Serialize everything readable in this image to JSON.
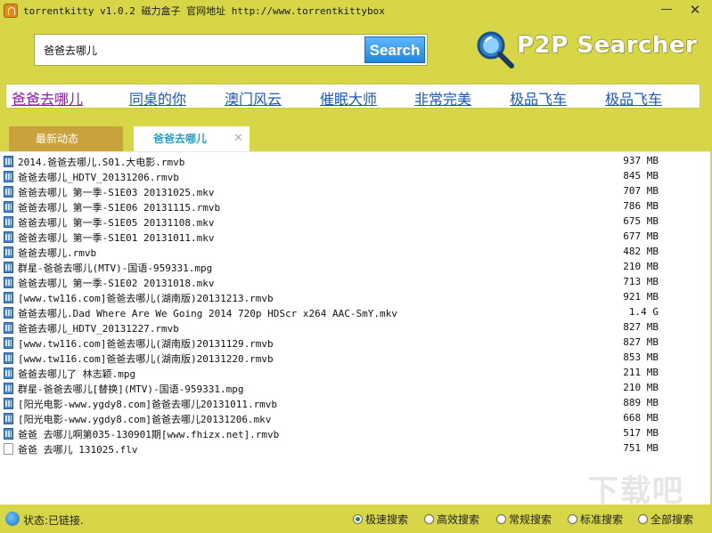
{
  "window": {
    "title": "torrentkitty  v1.0.2  磁力盒子  官网地址 http://www.torrentkittybox",
    "minimize_glyph": "—",
    "close_glyph": "✕"
  },
  "search": {
    "value": "爸爸去哪儿",
    "button_label": "Search"
  },
  "brand": {
    "text": "P2P Searcher",
    "icon": "magnifier-icon"
  },
  "hot_keywords": [
    "爸爸去哪儿",
    "同桌的你",
    "澳门风云",
    "催眠大师",
    "非常完美",
    "极品飞车",
    "极品飞车"
  ],
  "tabs": {
    "news_label": "最新动态",
    "active_label": "爸爸去哪儿",
    "close_glyph": "✕"
  },
  "results": [
    {
      "name": "2014.爸爸去哪儿.S01.大电影.rmvb",
      "size": "937 MB",
      "icon": "video-file-icon"
    },
    {
      "name": "爸爸去哪儿_HDTV_20131206.rmvb",
      "size": "845 MB",
      "icon": "video-file-icon"
    },
    {
      "name": "爸爸去哪儿 第一季-S1E03 20131025.mkv",
      "size": "707 MB",
      "icon": "video-file-icon"
    },
    {
      "name": "爸爸去哪儿 第一季-S1E06 20131115.rmvb",
      "size": "786 MB",
      "icon": "video-file-icon"
    },
    {
      "name": "爸爸去哪儿 第一季-S1E05 20131108.mkv",
      "size": "675 MB",
      "icon": "video-file-icon"
    },
    {
      "name": "爸爸去哪儿 第一季-S1E01 20131011.mkv",
      "size": "677 MB",
      "icon": "video-file-icon"
    },
    {
      "name": "爸爸去哪儿.rmvb",
      "size": "482 MB",
      "icon": "video-file-icon"
    },
    {
      "name": "群星-爸爸去哪儿(MTV)-国语-959331.mpg",
      "size": "210 MB",
      "icon": "video-file-icon"
    },
    {
      "name": "爸爸去哪儿 第一季-S1E02 20131018.mkv",
      "size": "713 MB",
      "icon": "video-file-icon"
    },
    {
      "name": "[www.tw116.com]爸爸去哪儿(湖南版)20131213.rmvb",
      "size": "921 MB",
      "icon": "video-file-icon"
    },
    {
      "name": "爸爸去哪儿.Dad Where Are We Going 2014 720p HDScr x264 AAC-SmY.mkv",
      "size": "1.4 G",
      "icon": "video-file-icon"
    },
    {
      "name": "爸爸去哪儿_HDTV_20131227.rmvb",
      "size": "827 MB",
      "icon": "video-file-icon"
    },
    {
      "name": "[www.tw116.com]爸爸去哪儿(湖南版)20131129.rmvb",
      "size": "827 MB",
      "icon": "video-file-icon"
    },
    {
      "name": "[www.tw116.com]爸爸去哪儿(湖南版)20131220.rmvb",
      "size": "853 MB",
      "icon": "video-file-icon"
    },
    {
      "name": "爸爸去哪儿了 林志颖.mpg",
      "size": "211 MB",
      "icon": "video-file-icon"
    },
    {
      "name": "群星-爸爸去哪儿[替换](MTV)-国语-959331.mpg",
      "size": "210 MB",
      "icon": "video-file-icon"
    },
    {
      "name": "[阳光电影-www.ygdy8.com]爸爸去哪儿20131011.rmvb",
      "size": "889 MB",
      "icon": "video-file-icon"
    },
    {
      "name": "[阳光电影-www.ygdy8.com]爸爸去哪儿20131206.mkv",
      "size": "668 MB",
      "icon": "video-file-icon"
    },
    {
      "name": "爸爸 去哪儿啊第035-130901期[www.fhizx.net].rmvb",
      "size": "517 MB",
      "icon": "video-file-icon"
    },
    {
      "name": "爸爸 去哪儿 131025.flv",
      "size": "751 MB",
      "icon": "document-file-icon"
    }
  ],
  "watermark": "下载吧",
  "status": {
    "text": "状态:已链接.",
    "icon": "globe-icon"
  },
  "modes": [
    {
      "label": "极速搜索",
      "selected": true
    },
    {
      "label": "高效搜索",
      "selected": false
    },
    {
      "label": "常规搜索",
      "selected": false
    },
    {
      "label": "标准搜索",
      "selected": false
    },
    {
      "label": "全部搜索",
      "selected": false
    }
  ],
  "colors": {
    "window_bg": "#d6d646",
    "search_button": "#1f86df",
    "link": "#1a56c6",
    "tab_active_text": "#2aa0c8"
  }
}
